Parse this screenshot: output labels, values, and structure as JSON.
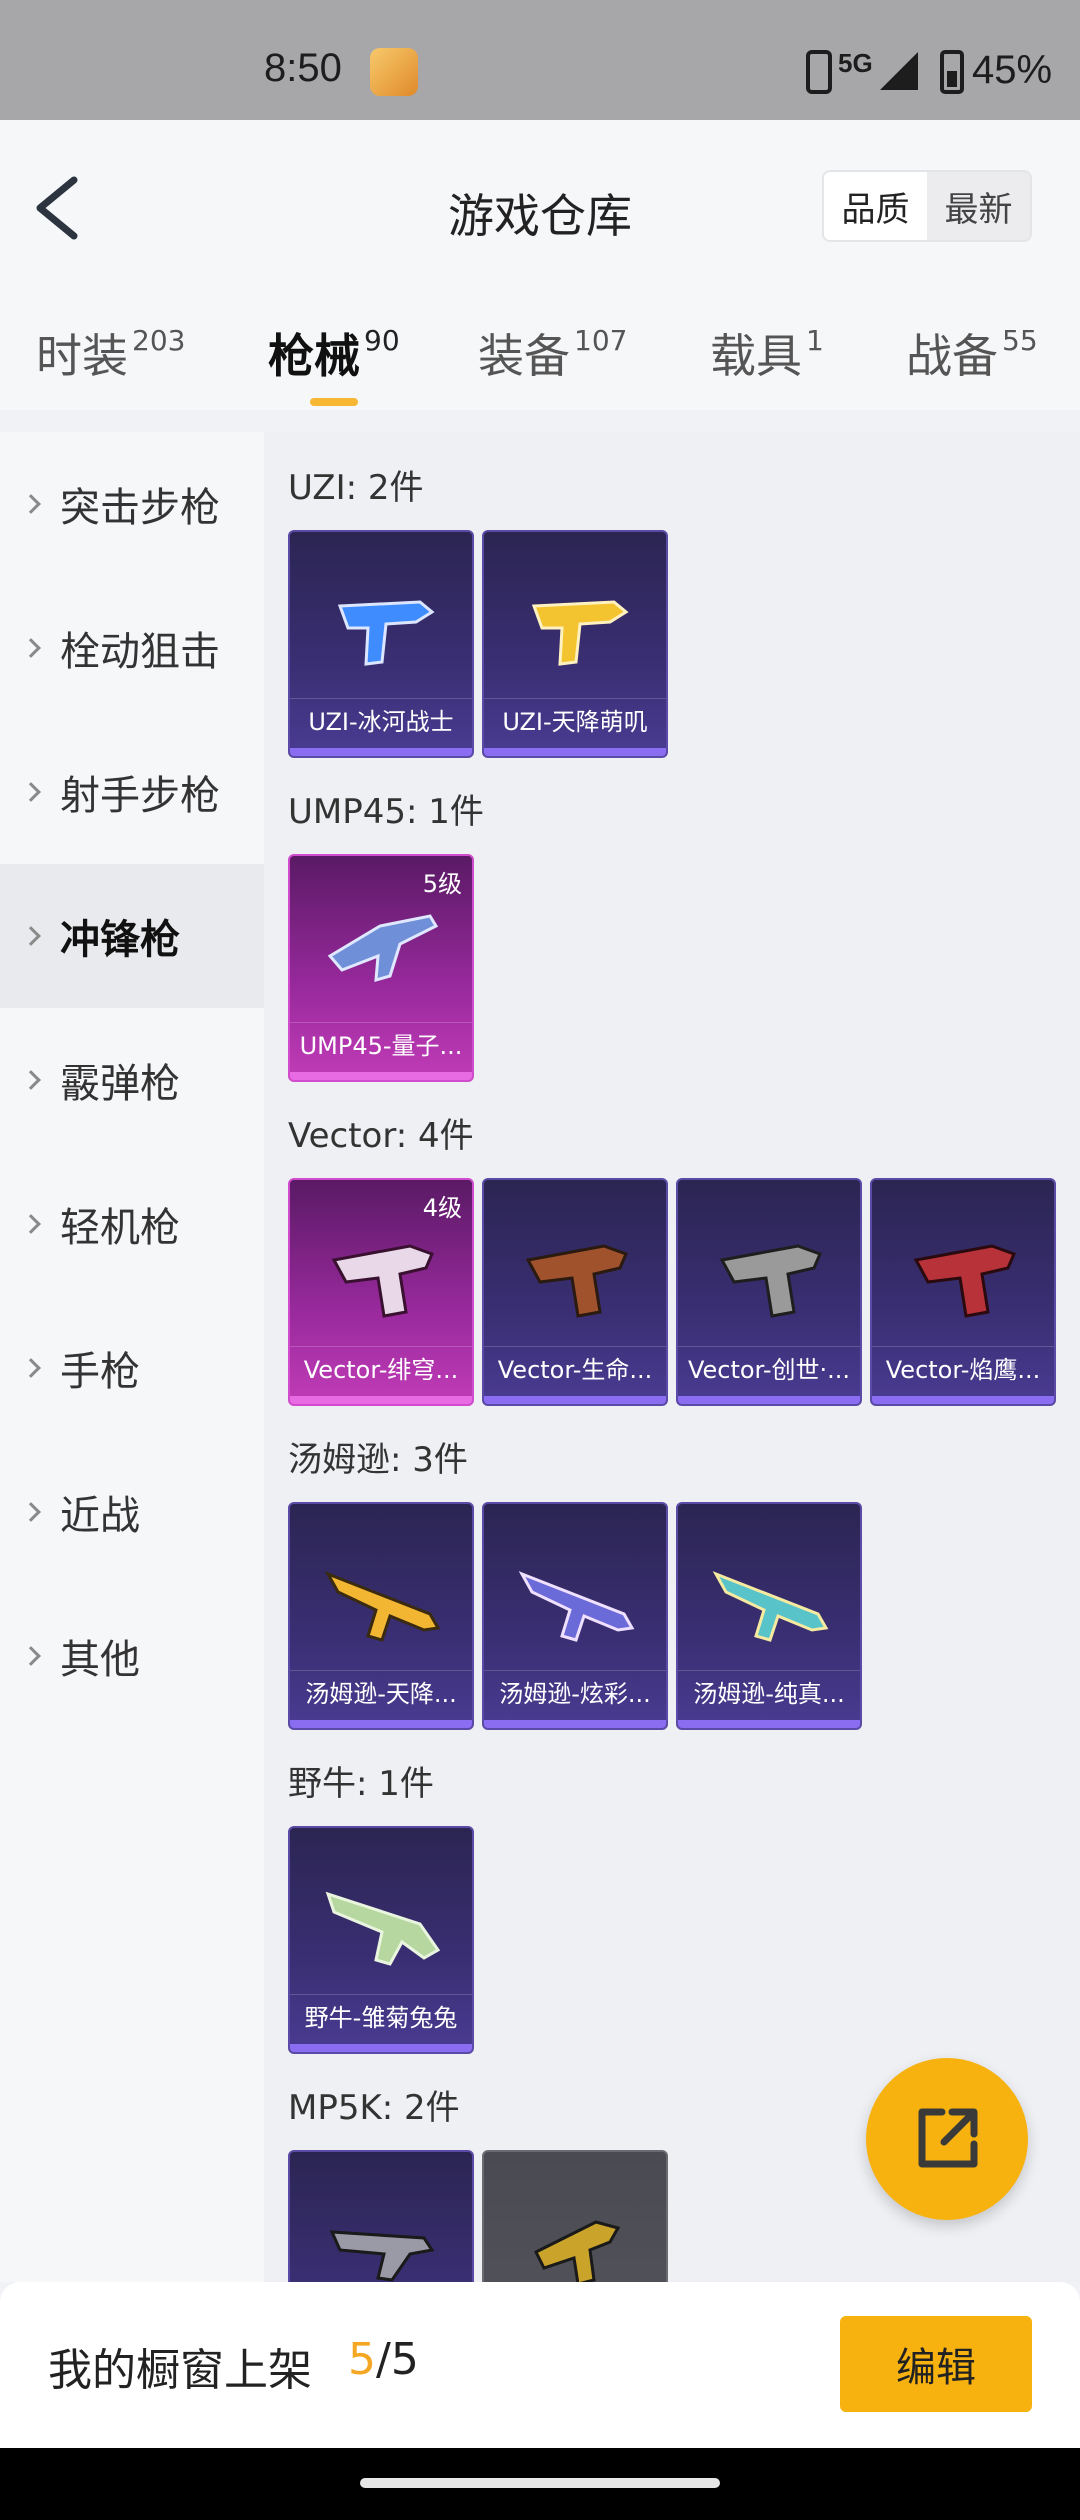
{
  "status": {
    "time": "8:50",
    "network": "5G",
    "battery": "45%"
  },
  "header": {
    "title": "游戏仓库",
    "sort": {
      "options": [
        "品质",
        "最新"
      ],
      "selected": "品质"
    }
  },
  "tabs": [
    {
      "label": "时装",
      "count": "203"
    },
    {
      "label": "枪械",
      "count": "90",
      "active": true
    },
    {
      "label": "装备",
      "count": "107"
    },
    {
      "label": "载具",
      "count": "1"
    },
    {
      "label": "战备",
      "count": "55"
    }
  ],
  "sidebar": {
    "items": [
      "突击步枪",
      "栓动狙击",
      "射手步枪",
      "冲锋枪",
      "霰弹枪",
      "轻机枪",
      "手枪",
      "近战",
      "其他"
    ],
    "active": "冲锋枪"
  },
  "groups": [
    {
      "title": "UZI: 2件",
      "items": [
        {
          "name": "UZI-冰河战士",
          "quality": "purple",
          "color": "#3f8cff"
        },
        {
          "name": "UZI-天降萌叽",
          "quality": "purple",
          "color": "#f4c430"
        }
      ]
    },
    {
      "title": "UMP45: 1件",
      "items": [
        {
          "name": "UMP45-量子...",
          "quality": "pink",
          "level": "5级",
          "color": "#6f8fd8"
        }
      ]
    },
    {
      "title": "Vector: 4件",
      "items": [
        {
          "name": "Vector-绯穹...",
          "quality": "pink",
          "level": "4级",
          "color": "#e8d8e8"
        },
        {
          "name": "Vector-生命...",
          "quality": "purple",
          "color": "#a0522d"
        },
        {
          "name": "Vector-创世·...",
          "quality": "purple",
          "color": "#9a9a9a"
        },
        {
          "name": "Vector-焰鹰...",
          "quality": "purple",
          "color": "#b8323a"
        }
      ]
    },
    {
      "title": "汤姆逊: 3件",
      "items": [
        {
          "name": "汤姆逊-天降...",
          "quality": "purple",
          "color": "#f2b632"
        },
        {
          "name": "汤姆逊-炫彩...",
          "quality": "purple",
          "color": "#6a6ad8"
        },
        {
          "name": "汤姆逊-纯真...",
          "quality": "purple",
          "color": "#58c3c9"
        }
      ]
    },
    {
      "title": "野牛: 1件",
      "items": [
        {
          "name": "野牛-雏菊兔兔",
          "quality": "purple",
          "color": "#b6d8a0"
        }
      ]
    },
    {
      "title": "MP5K: 2件",
      "items": [
        {
          "name": "",
          "quality": "purple",
          "color": "#9a9aa6"
        },
        {
          "name": "",
          "quality": "gray",
          "color": "#c9a32a"
        }
      ]
    }
  ],
  "bottom": {
    "label": "我的橱窗上架",
    "current": "5",
    "total": "/5",
    "edit_label": "编辑"
  },
  "colors": {
    "accent": "#f7b20f",
    "purple_card": "#3a2f74",
    "pink_card": "#9a2a9e"
  },
  "icons": {
    "back": "chevron-left-icon",
    "share": "external-link-icon"
  }
}
